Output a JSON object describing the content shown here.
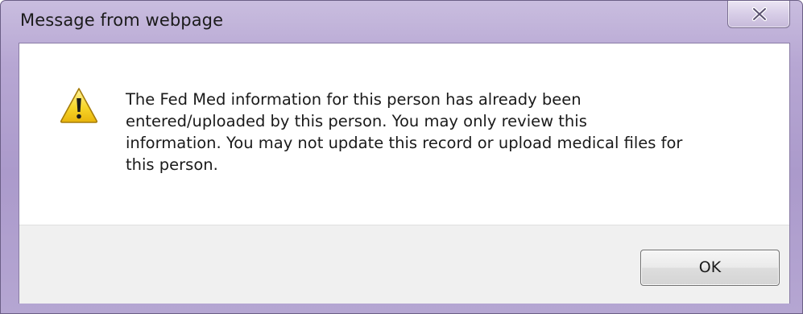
{
  "window": {
    "title": "Message from webpage",
    "close_icon": "close-x-icon"
  },
  "dialog": {
    "icon": "warning-icon",
    "message": "The Fed Med information for this person has already been\nentered/uploaded by this person.  You may only review this\ninformation. You may not update this record or upload medical files for\nthis person.",
    "ok_label": "OK"
  },
  "colors": {
    "titlebar": "#b7a7d3",
    "client_background": "#ffffff",
    "footer_background": "#f0f0f0",
    "warning_yellow": "#f5d31f"
  }
}
